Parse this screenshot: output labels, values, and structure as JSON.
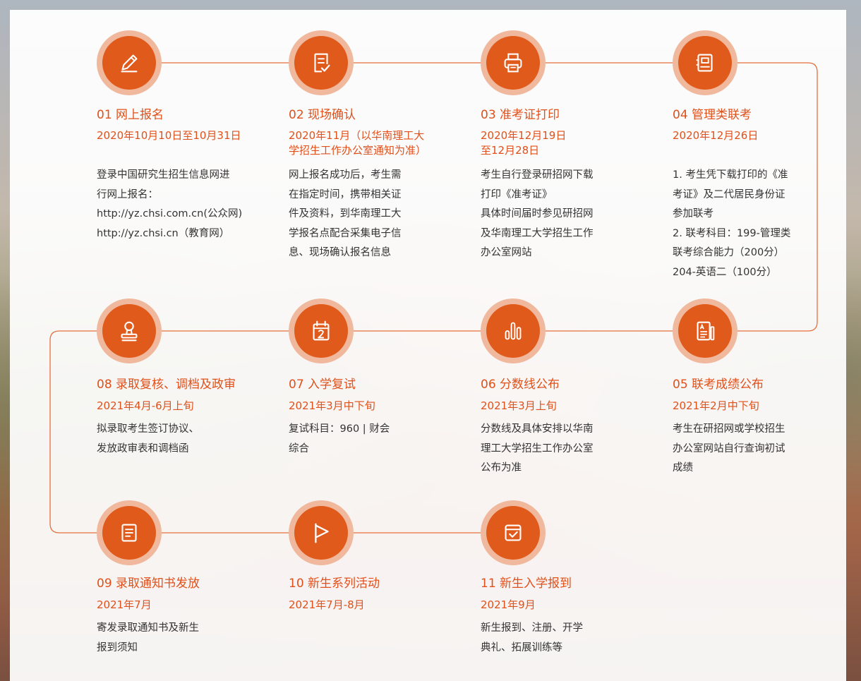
{
  "steps": [
    {
      "title": "01 网上报名",
      "date": [
        "2020年10月10日至10月31日"
      ],
      "desc": [
        "登录中国研究生招生信息网进",
        "行网上报名：",
        "http://yz.chsi.com.cn(公众网)",
        "http://yz.chsi.cn（教育网）"
      ],
      "icon": "pencil-icon"
    },
    {
      "title": "02 现场确认",
      "date": [
        "2020年11月（以华南理工大",
        "学招生工作办公室通知为准）"
      ],
      "desc": [
        "网上报名成功后，考生需",
        "在指定时间，携带相关证",
        "件及资料，到华南理工大",
        "学报名点配合采集电子信",
        "息、现场确认报名信息"
      ],
      "icon": "checklist-icon"
    },
    {
      "title": "03 准考证打印",
      "date": [
        "2020年12月19日",
        "至12月28日"
      ],
      "desc": [
        "考生自行登录研招网下载",
        "打印《准考证》",
        "具体时间届时参见研招网",
        "及华南理工大学招生工作",
        "办公室网站"
      ],
      "icon": "printer-icon"
    },
    {
      "title": "04 管理类联考",
      "date": [
        "2020年12月26日"
      ],
      "desc": [
        "1. 考生凭下载打印的《准",
        "考证》及二代居民身份证",
        "参加联考",
        "2. 联考科目：199-管理类",
        "联考综合能力（200分）",
        "204-英语二（100分）"
      ],
      "icon": "exam-paper-icon"
    },
    {
      "title": "08 录取复核、调档及政审",
      "date": [
        "2021年4月-6月上旬"
      ],
      "desc": [
        "拟录取考生签订协议、",
        "发放政审表和调档函"
      ],
      "icon": "stamp-icon"
    },
    {
      "title": "07 入学复试",
      "date": [
        "2021年3月中下旬"
      ],
      "desc": [
        "复试科目：960 | 财会",
        "综合"
      ],
      "icon": "calendar-icon"
    },
    {
      "title": "06 分数线公布",
      "date": [
        "2021年3月上旬"
      ],
      "desc": [
        "分数线及具体安排以华南",
        "理工大学招生工作办公室",
        "公布为准"
      ],
      "icon": "bar-chart-icon"
    },
    {
      "title": "05 联考成绩公布",
      "date": [
        "2021年2月中下旬"
      ],
      "desc": [
        "考生在研招网或学校招生",
        "办公室网站自行查询初试",
        "成绩"
      ],
      "icon": "score-report-icon"
    },
    {
      "title": "09 录取通知书发放",
      "date": [
        "2021年7月"
      ],
      "desc": [
        "寄发录取通知书及新生",
        "报到须知"
      ],
      "icon": "notice-icon"
    },
    {
      "title": "10 新生系列活动",
      "date": [
        "2021年7月-8月"
      ],
      "desc": [],
      "icon": "flag-icon"
    },
    {
      "title": "11 新生入学报到",
      "date": [
        "2021年9月"
      ],
      "desc": [
        "新生报到、注册、开学",
        "典礼、拓展训练等"
      ],
      "icon": "checkbox-icon"
    }
  ],
  "colors": {
    "accent": "#e05a1b",
    "accent_light": "#f0b89d",
    "text": "#333333"
  }
}
